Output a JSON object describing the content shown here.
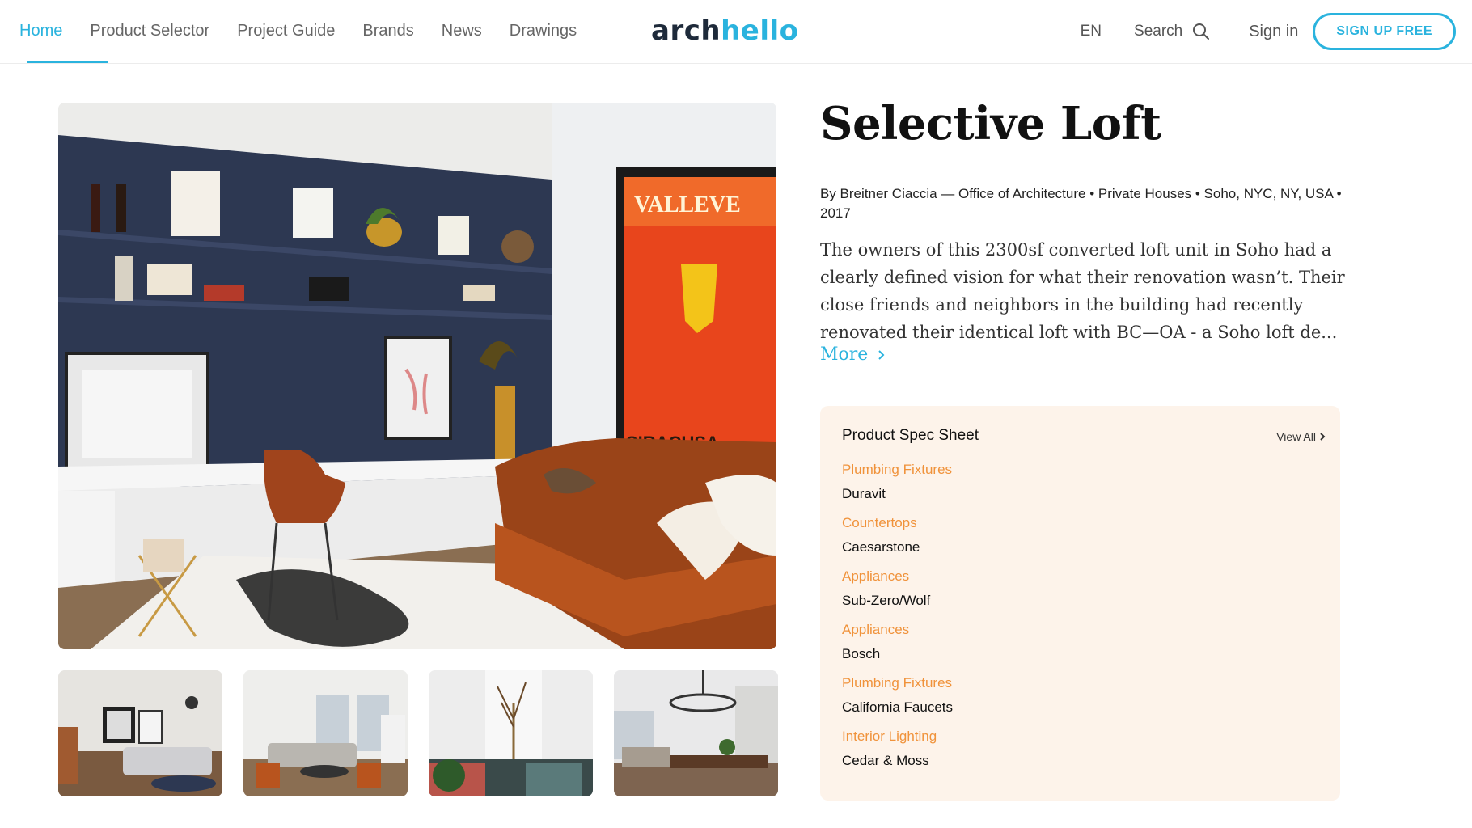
{
  "nav": {
    "items": [
      {
        "label": "Home",
        "active": true
      },
      {
        "label": "Product Selector"
      },
      {
        "label": "Project Guide"
      },
      {
        "label": "Brands"
      },
      {
        "label": "News"
      },
      {
        "label": "Drawings"
      }
    ]
  },
  "logo": {
    "part1": "arch",
    "part2": "hello"
  },
  "header_right": {
    "lang": "EN",
    "search": "Search",
    "signin": "Sign in",
    "signup": "SIGN UP FREE"
  },
  "project": {
    "title": "Selective Loft",
    "byline": "By Breitner Ciaccia — Office of Architecture • Private Houses • Soho, NYC, NY, USA • 2017",
    "description": "The owners of this 2300sf converted loft unit in Soho had a clearly defined vision for what their renovation wasn’t. Their close friends and neighbors in the building had recently renovated their identical loft with BC—OA - a Soho loft de...",
    "more": "More"
  },
  "spec_sheet": {
    "title": "Product Spec Sheet",
    "view_all": "View All",
    "items": [
      {
        "category": "Plumbing Fixtures",
        "brand": "Duravit"
      },
      {
        "category": "Countertops",
        "brand": "Caesarstone"
      },
      {
        "category": "Appliances",
        "brand": "Sub-Zero/Wolf"
      },
      {
        "category": "Appliances",
        "brand": "Bosch"
      },
      {
        "category": "Plumbing Fixtures",
        "brand": "California Faucets"
      },
      {
        "category": "Interior Lighting",
        "brand": "Cedar & Moss"
      }
    ]
  },
  "colors": {
    "accent": "#2ab3de",
    "spec_category": "#f0923a",
    "spec_bg": "#fdf3ea"
  }
}
